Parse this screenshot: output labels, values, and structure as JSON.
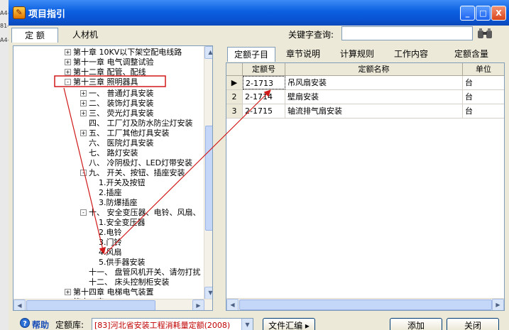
{
  "background": {
    "fragments": [
      "A4-",
      "81-",
      "A4-"
    ]
  },
  "window": {
    "title": "项目指引"
  },
  "titlebar_buttons": {
    "min": "_",
    "max": "□",
    "close": "X"
  },
  "top_tabs": [
    "定 额",
    "人材机"
  ],
  "search": {
    "label": "关键字查询:",
    "value": ""
  },
  "tree": {
    "nodes": [
      {
        "text": "第十章 10KV以下架空配电线路",
        "toggle": "+"
      },
      {
        "text": "第十一章 电气调整试验",
        "toggle": "+"
      },
      {
        "text": "第十二章 配管、配线",
        "toggle": "+"
      },
      {
        "text": "第十三章 照明器具",
        "toggle": "-"
      },
      {
        "text": "一、 普通灯具安装",
        "toggle": "+"
      },
      {
        "text": "二、 装饰灯具安装",
        "toggle": "+"
      },
      {
        "text": "三、 荧光灯具安装",
        "toggle": "+"
      },
      {
        "text": "四、 工厂灯及防水防尘灯安装",
        "toggle": ""
      },
      {
        "text": "五、 工厂其他灯具安装",
        "toggle": "+"
      },
      {
        "text": "六、 医院灯具安装",
        "toggle": ""
      },
      {
        "text": "七、 路灯安装",
        "toggle": ""
      },
      {
        "text": "八、 冷阴极灯、LED灯带安装",
        "toggle": ""
      },
      {
        "text": "九、 开关、按钮、插座安装",
        "toggle": "-"
      },
      {
        "text": "1.开关及按钮",
        "toggle": ""
      },
      {
        "text": "2.插座",
        "toggle": ""
      },
      {
        "text": "3.防爆插座",
        "toggle": ""
      },
      {
        "text": "十、 安全变压器、电铃、风扇、",
        "toggle": "-"
      },
      {
        "text": "1.安全变压器",
        "toggle": ""
      },
      {
        "text": "2.电铃",
        "toggle": ""
      },
      {
        "text": "3.门铃",
        "toggle": ""
      },
      {
        "text": "4.风扇",
        "toggle": ""
      },
      {
        "text": "5.供手器安装",
        "toggle": ""
      },
      {
        "text": "十一、 盘管风机开关、请勿打扰",
        "toggle": ""
      },
      {
        "text": "十二、 床头控制柜安装",
        "toggle": ""
      },
      {
        "text": "第十四章 电梯电气装置",
        "toggle": "+"
      },
      {
        "text": "第十五章 …",
        "toggle": "+"
      }
    ]
  },
  "right_tabs": [
    "定额子目",
    "章节说明",
    "计算规则",
    "工作内容",
    "定额含量"
  ],
  "grid": {
    "headers": [
      "定额号",
      "定额名称",
      "单位"
    ],
    "rows": [
      {
        "idx": "1",
        "code": "2-1713",
        "name": "吊风扇安装",
        "unit": "台"
      },
      {
        "idx": "2",
        "code": "2-1714",
        "name": "壁扇安装",
        "unit": "台"
      },
      {
        "idx": "3",
        "code": "2-1715",
        "name": "轴流排气扇安装",
        "unit": "台"
      }
    ]
  },
  "bottom": {
    "help_label": "帮助",
    "quota_label": "定额库:",
    "quota_value": "[83]河北省安装工程消耗量定额(2008)",
    "file_button": "文件汇编",
    "add_button": "添加",
    "close_button": "关闭"
  },
  "colors": {
    "highlight_box": "#d01818",
    "arrow": "#d01818",
    "titlebar": "#0a54d4",
    "quota_text": "#c00000"
  },
  "icons": [
    "app-icon",
    "binoculars-icon",
    "help-icon",
    "row-pointer-icon",
    "combo-arrow-icon"
  ]
}
